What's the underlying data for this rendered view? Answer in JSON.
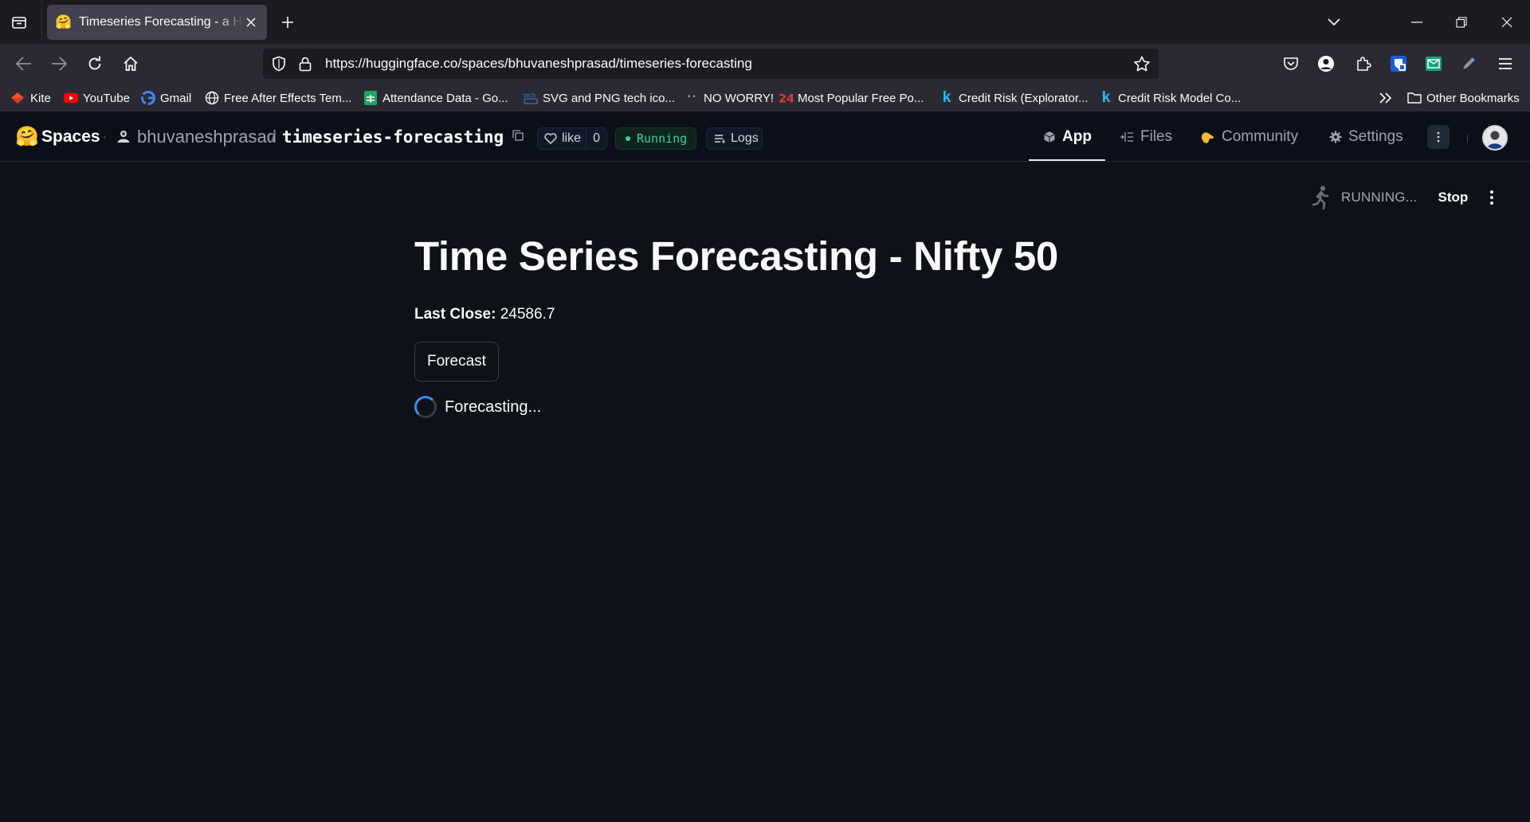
{
  "browser": {
    "tab": {
      "title": "Timeseries Forecasting - a Hugging Face Space",
      "favicon": "hugging-face-emoji"
    },
    "url": "https://huggingface.co/spaces/bhuvaneshprasad/timeseries-forecasting",
    "bookmarks": [
      {
        "label": "Kite",
        "icon": "kite-icon",
        "color": "#f0502e"
      },
      {
        "label": "YouTube",
        "icon": "youtube-icon",
        "color": "#ff0000"
      },
      {
        "label": "Gmail",
        "icon": "google-icon",
        "color": "#4285f4"
      },
      {
        "label": "Free After Effects Tem...",
        "icon": "globe-icon",
        "color": "#fbfbfe"
      },
      {
        "label": "Attendance Data - Go...",
        "icon": "sheets-icon",
        "color": "#1fa463"
      },
      {
        "label": "SVG and PNG tech ico...",
        "icon": "techicons-icon",
        "color": "#3b82f6"
      },
      {
        "label": "NO WORRY!",
        "icon": "quote-icon",
        "color": "#fbfbfe"
      },
      {
        "label": "Most Popular Free Po...",
        "icon": "24-icon",
        "color": "#e53935"
      },
      {
        "label": "Credit Risk (Explorator...",
        "icon": "kaggle-icon",
        "color": "#20beff"
      },
      {
        "label": "Credit Risk Model Co...",
        "icon": "kaggle-icon",
        "color": "#20beff"
      }
    ],
    "other_bookmarks": "Other Bookmarks"
  },
  "hf_header": {
    "brand": "Spaces",
    "owner": "bhuvaneshprasad",
    "repo": "timeseries-forecasting",
    "like_label": "like",
    "like_count": "0",
    "status": "Running",
    "status_color": "#34d399",
    "logs_label": "Logs",
    "tabs": [
      {
        "label": "App",
        "icon": "cube-icon",
        "active": true
      },
      {
        "label": "Files",
        "icon": "files-icon",
        "active": false
      },
      {
        "label": "Community",
        "icon": "community-icon",
        "active": false
      },
      {
        "label": "Settings",
        "icon": "gear-icon",
        "active": false
      }
    ]
  },
  "app": {
    "status_text": "RUNNING...",
    "stop_label": "Stop",
    "title": "Time Series Forecasting - Nifty 50",
    "last_close_label": "Last Close:",
    "last_close_value": "24586.7",
    "forecast_button": "Forecast",
    "spinner_text": "Forecasting...",
    "accent_color": "#3d8bfd"
  }
}
